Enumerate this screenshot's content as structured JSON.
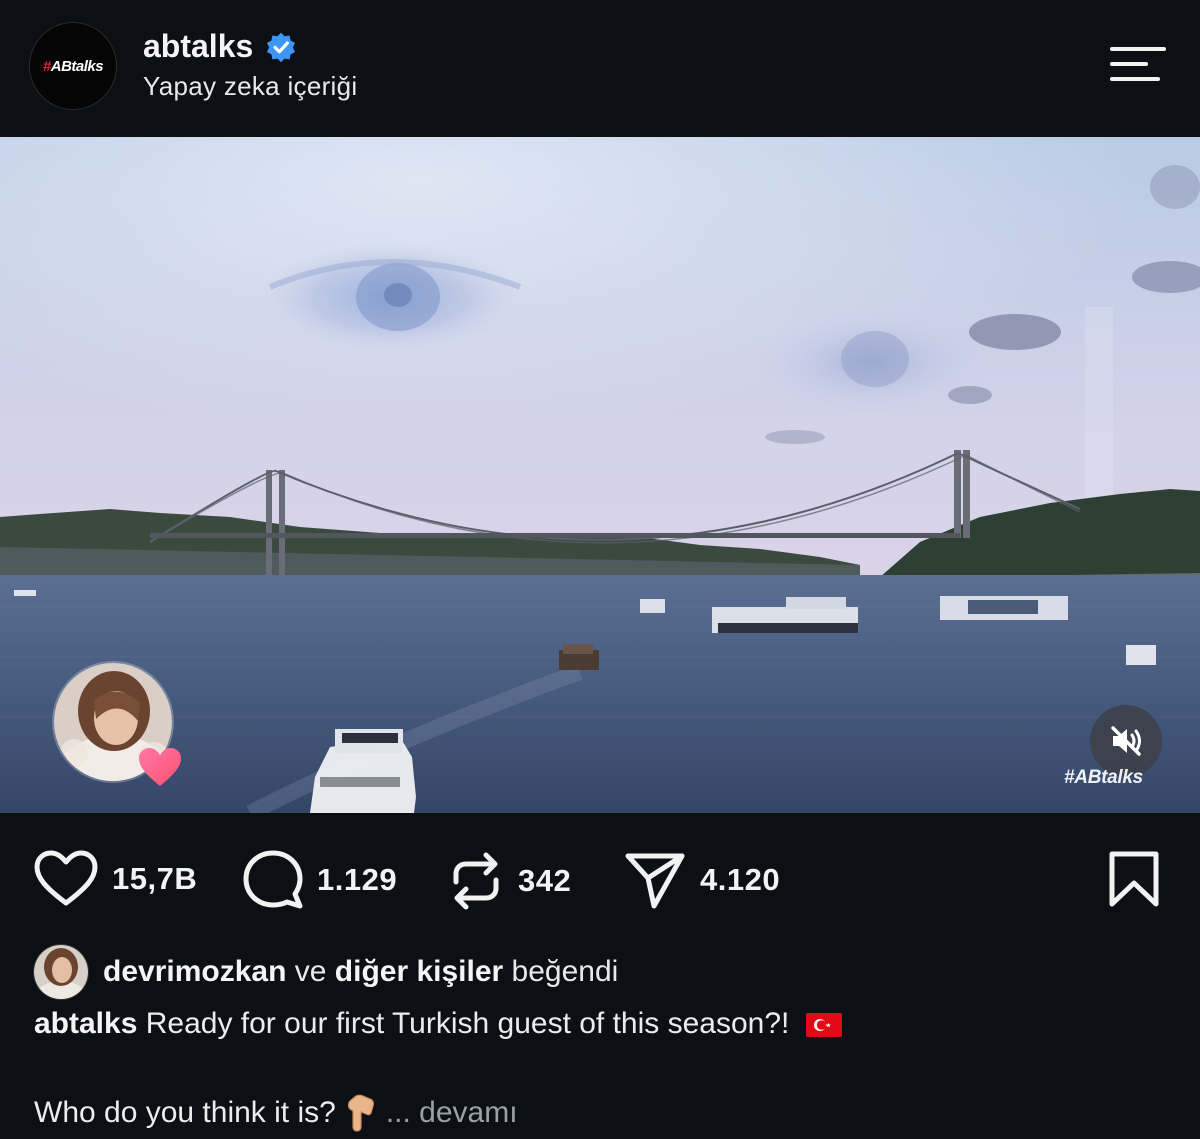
{
  "header": {
    "logo_prefix": "#",
    "logo_text": "ABtalks",
    "username": "abtalks",
    "subtitle": "Yapay zeka içeriği",
    "icons": {
      "verified": "verified-badge-icon",
      "menu": "menu-icon"
    },
    "colors": {
      "verified": "#3d95f5",
      "logo_accent": "#e02424"
    }
  },
  "media": {
    "watermark": "#ABtalks",
    "icons": {
      "mute": "muted-speaker-icon",
      "heart": "heart-badge-icon"
    }
  },
  "actions": {
    "likes": "15,7B",
    "comments": "1.129",
    "reposts": "342",
    "shares": "4.120",
    "icons": [
      "heart-icon",
      "comment-icon",
      "repost-icon",
      "send-icon",
      "bookmark-icon"
    ]
  },
  "liked_by": {
    "user": "devrimozkan",
    "connector": "ve",
    "others": "diğer kişiler",
    "verb": "beğendi"
  },
  "caption": {
    "username": "abtalks",
    "text": "Ready for our first Turkish guest of this season?!",
    "emoji_flag": "turkey-flag-icon",
    "line2": "Who do you think it is?",
    "emoji_pointing": "pointing-down-icon",
    "more": "... devamı"
  }
}
